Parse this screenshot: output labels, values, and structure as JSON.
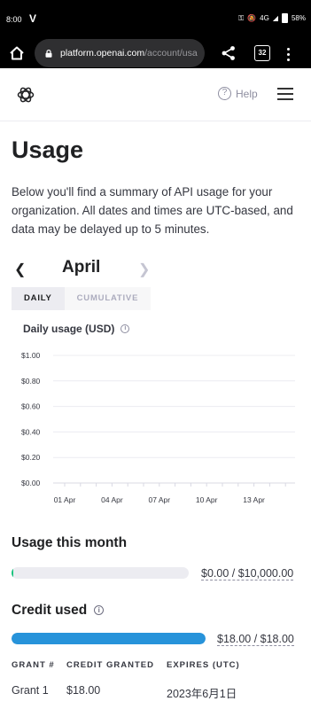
{
  "status_bar": {
    "time": "8:00",
    "network_label": "4G",
    "battery": "58%"
  },
  "browser": {
    "url_host": "platform.openai.com",
    "url_path": "/account/usa",
    "tab_count": "32"
  },
  "nav": {
    "help_label": "Help"
  },
  "page": {
    "title": "Usage",
    "intro": "Below you'll find a summary of API usage for your organization. All dates and times are UTC-based, and data may be delayed up to 5 minutes."
  },
  "month_nav": {
    "month": "April"
  },
  "view_toggle": {
    "daily": "DAILY",
    "cumulative": "CUMULATIVE",
    "active": "daily"
  },
  "chart_title": "Daily usage (USD)",
  "chart_data": {
    "type": "bar",
    "title": "Daily usage (USD)",
    "xlabel": "",
    "ylabel": "",
    "ylim": [
      0,
      1
    ],
    "y_ticks": [
      "$1.00",
      "$0.80",
      "$0.60",
      "$0.40",
      "$0.20",
      "$0.00"
    ],
    "y_tick_values": [
      1.0,
      0.8,
      0.6,
      0.4,
      0.2,
      0.0
    ],
    "x_ticks": [
      "01 Apr",
      "04 Apr",
      "07 Apr",
      "10 Apr",
      "13 Apr"
    ],
    "categories": [
      "01 Apr",
      "02 Apr",
      "03 Apr",
      "04 Apr",
      "05 Apr",
      "06 Apr",
      "07 Apr",
      "08 Apr",
      "09 Apr",
      "10 Apr",
      "11 Apr",
      "12 Apr",
      "13 Apr",
      "14 Apr",
      "15 Apr"
    ],
    "values": [
      0,
      0,
      0,
      0,
      0,
      0,
      0,
      0,
      0,
      0,
      0,
      0,
      0,
      0,
      0
    ],
    "grid": true
  },
  "usage_this_month": {
    "title": "Usage this month",
    "value_text": "$0.00 / $10,000.00",
    "fraction": 0.0,
    "color": "#19c37d"
  },
  "credit_used": {
    "title": "Credit used",
    "value_text": "$18.00 / $18.00",
    "fraction": 1.0,
    "color": "#2793da"
  },
  "grants": {
    "headers": [
      "GRANT #",
      "CREDIT GRANTED",
      "EXPIRES (UTC)"
    ],
    "rows": [
      {
        "grant": "Grant 1",
        "credit": "$18.00",
        "expires": "2023年6月1日"
      }
    ]
  },
  "colors": {
    "accent_blue": "#2793da",
    "text_dark": "#202123",
    "track_gray": "#ececf1"
  }
}
